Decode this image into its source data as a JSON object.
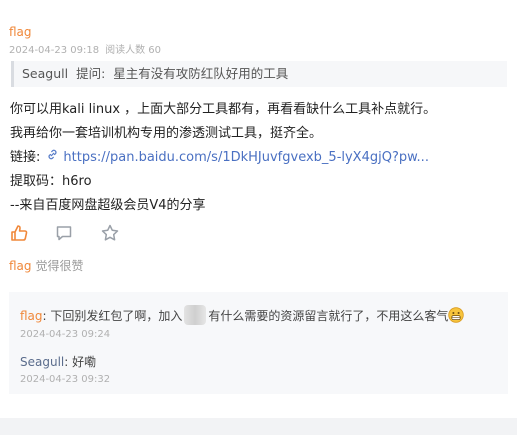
{
  "post": {
    "author": "flag",
    "date": "2024-04-23 09:18",
    "views_label": "阅读人数 60",
    "quote": {
      "user": "Seagull",
      "label": "提问:",
      "text": "星主有没有攻防红队好用的工具"
    },
    "body_lines": [
      "你可以用kali linux ，上面大部分工具都有，再看看缺什么工具补点就行。",
      "我再给你一套培训机构专用的渗透测试工具，挺齐全。"
    ],
    "link_label": "链接:",
    "link_icon": "link-icon",
    "link_text": "https://pan.baidu.com/s/1DkHJuvfgvexb_5-lyX4gjQ?pw...",
    "code_line": "提取码：h6ro",
    "footer_line": "--来自百度网盘超级会员V4的分享"
  },
  "actions": {
    "like_icon": "thumbs-up-icon",
    "comment_icon": "comment-icon",
    "star_icon": "star-icon",
    "accent_color": "#f0883a"
  },
  "liked": {
    "user": "flag",
    "text": "觉得很赞"
  },
  "replies": [
    {
      "user": "flag",
      "text_before": ": 下回别发红包了啊，加入",
      "text_after": "有什么需要的资源留言就行了，不用这么客气",
      "emoji": "grinning-face-icon",
      "time": "2024-04-23 09:24"
    },
    {
      "user": "Seagull",
      "text": ": 好嘞",
      "time": "2024-04-23 09:32"
    }
  ]
}
